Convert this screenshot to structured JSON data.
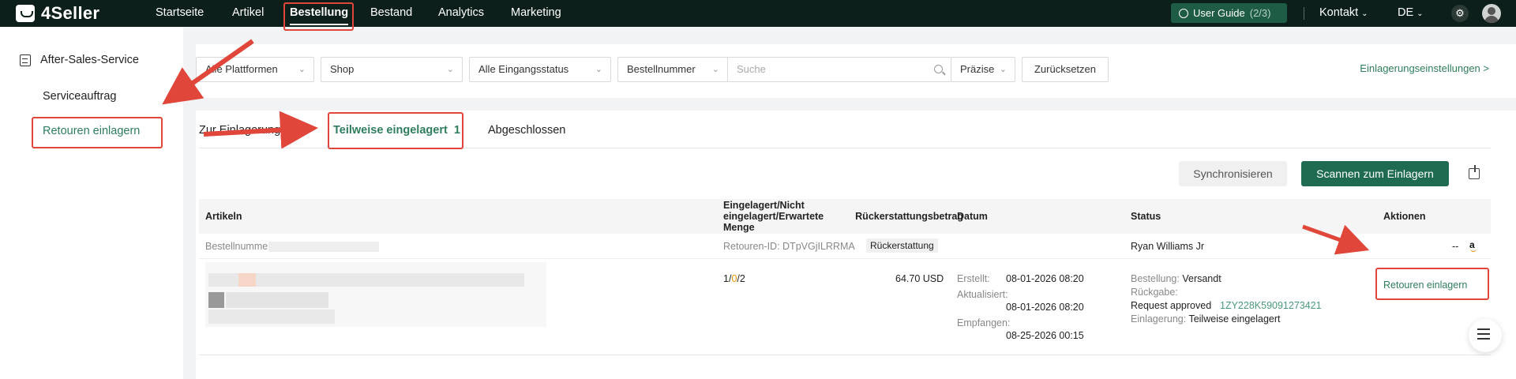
{
  "app": {
    "logo": "4Seller"
  },
  "nav": {
    "items": [
      "Startseite",
      "Artikel",
      "Bestellung",
      "Bestand",
      "Analytics",
      "Marketing"
    ],
    "user_guide": "User Guide",
    "user_guide_count": "(2/3)",
    "kontakt": "Kontakt",
    "lang": "DE"
  },
  "sidebar": {
    "section": "After-Sales-Service",
    "items": [
      "Serviceauftrag",
      "Retouren einlagern"
    ]
  },
  "filters": {
    "platform": "Alle Plattformen",
    "shop": "Shop",
    "status": "Alle Eingangsstatus",
    "field": "Bestellnummer",
    "search_placeholder": "Suche",
    "precision": "Präzise",
    "reset": "Zurücksetzen",
    "settings_link": "Einlagerungseinstellungen >"
  },
  "tabs": [
    {
      "label": "Zur Einlagerung"
    },
    {
      "label": "Teilweise eingelagert",
      "count": "1"
    },
    {
      "label": "Abgeschlossen"
    }
  ],
  "buttons": {
    "sync": "Synchronisieren",
    "scan": "Scannen zum Einlagern"
  },
  "table": {
    "headers": [
      "Artikeln",
      "Eingelagert/Nicht eingelagert/Erwartete Menge",
      "Rückerstattungsbetrag",
      "Datum",
      "Status",
      "Aktionen"
    ],
    "order_label": "Bestellnummer:",
    "return_id": "Retouren-ID: DTpVGjILRRMA",
    "refund_tag": "Rückerstattung",
    "customer": "Ryan Williams Jr",
    "dashes": "--",
    "platform_logo": "a",
    "qty": {
      "in": "1",
      "sep1": "/",
      "not": "0",
      "sep2": "/",
      "expected": "2"
    },
    "amount": "64.70 USD",
    "dates": [
      {
        "label": "Erstellt:",
        "value": "08-01-2026 08:20"
      },
      {
        "label": "Aktualisiert:",
        "value": "08-01-2026 08:20"
      },
      {
        "label": "Empfangen:",
        "value": "08-25-2026 00:15"
      }
    ],
    "status": {
      "order_label": "Bestellung:",
      "order_value": "Versandt",
      "return_label": "Rückgabe:",
      "return_value": "Request approved",
      "tracking": "1ZY228K59091273421",
      "storage_label": "Einlagerung:",
      "storage_value": "Teilweise eingelagert"
    },
    "action": "Retouren einlagern"
  },
  "colors": {
    "accent": "#2e7d5b",
    "highlight": "#e0463a",
    "nav_bg": "#0d1f1a",
    "qty_zero": "#f39200"
  }
}
